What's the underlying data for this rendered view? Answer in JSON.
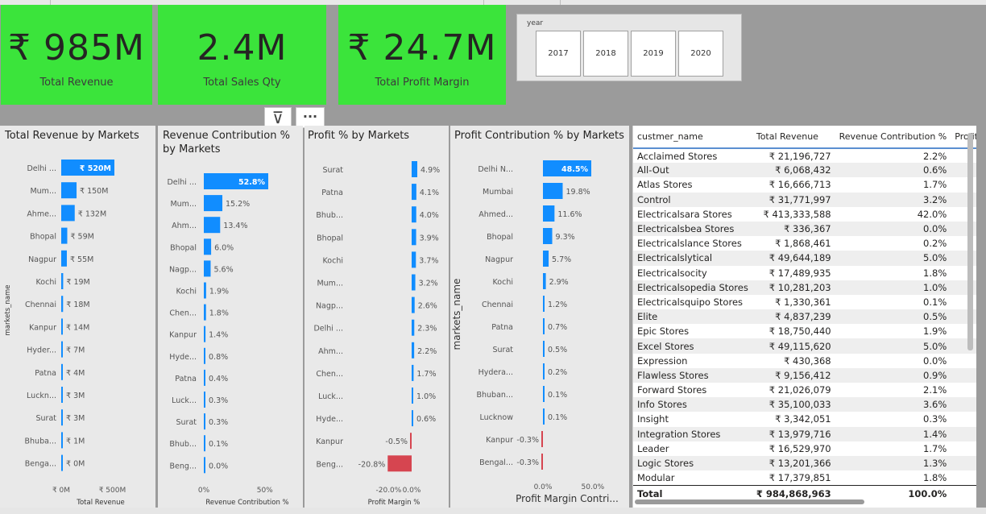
{
  "cards": [
    {
      "value": "₹ 985M",
      "label": "Total Revenue"
    },
    {
      "value": "2.4M",
      "label": "Total Sales Qty"
    },
    {
      "value": "₹ 24.7M",
      "label": "Total Profit Margin"
    }
  ],
  "slicer": {
    "title": "year",
    "options": [
      "2017",
      "2018",
      "2019",
      "2020"
    ]
  },
  "header_icons": {
    "filter": "⊽",
    "more": "···"
  },
  "colors": {
    "accent": "#118dff",
    "negative": "#d64550",
    "card_bg": "#3be43b"
  },
  "chart_data": [
    {
      "type": "bar",
      "title": "Total Revenue by Markets",
      "ylabel": "markets_name",
      "xlabel": "Total Revenue",
      "categories": [
        "Delhi ...",
        "Mum...",
        "Ahme...",
        "Bhopal",
        "Nagpur",
        "Kochi",
        "Chennai",
        "Kanpur",
        "Hyder...",
        "Patna",
        "Luckn...",
        "Surat",
        "Bhuba...",
        "Benga..."
      ],
      "values": [
        520,
        150,
        132,
        59,
        55,
        19,
        18,
        14,
        7,
        4,
        3,
        3,
        1,
        0
      ],
      "data_labels": [
        "₹ 520M",
        "₹ 150M",
        "₹ 132M",
        "₹ 59M",
        "₹ 55M",
        "₹ 19M",
        "₹ 18M",
        "₹ 14M",
        "₹ 7M",
        "₹ 4M",
        "₹ 3M",
        "₹ 3M",
        "₹ 1M",
        "₹ 0M"
      ],
      "xlim": [
        0,
        520
      ],
      "xticks": [
        "₹ 0M",
        "₹ 500M"
      ],
      "xtick_values": [
        0,
        500
      ]
    },
    {
      "type": "bar",
      "title": "Revenue Contribution % by Markets",
      "xlabel": "Revenue Contribution %",
      "categories": [
        "Delhi ...",
        "Mum...",
        "Ahm...",
        "Bhopal",
        "Nagp...",
        "Kochi",
        "Chen...",
        "Kanpur",
        "Hyde...",
        "Patna",
        "Luck...",
        "Surat",
        "Bhub...",
        "Beng..."
      ],
      "values": [
        52.8,
        15.2,
        13.4,
        6.0,
        5.6,
        1.9,
        1.8,
        1.4,
        0.8,
        0.4,
        0.3,
        0.3,
        0.1,
        0.0
      ],
      "data_labels": [
        "52.8%",
        "15.2%",
        "13.4%",
        "6.0%",
        "5.6%",
        "1.9%",
        "1.8%",
        "1.4%",
        "0.8%",
        "0.4%",
        "0.3%",
        "0.3%",
        "0.1%",
        "0.0%"
      ],
      "xlim": [
        0,
        52.8
      ],
      "xticks": [
        "0%",
        "50%"
      ],
      "xtick_values": [
        0,
        50
      ]
    },
    {
      "type": "bar",
      "title": "Profit % by Markets",
      "xlabel": "Profit Margin %",
      "categories": [
        "Surat",
        "Patna",
        "Bhub...",
        "Bhopal",
        "Kochi",
        "Mum...",
        "Nagp...",
        "Delhi ...",
        "Ahm...",
        "Chen...",
        "Luck...",
        "Hyde...",
        "Kanpur",
        "Beng..."
      ],
      "values": [
        4.9,
        4.1,
        4.0,
        3.9,
        3.7,
        3.2,
        2.6,
        2.3,
        2.2,
        1.7,
        1.0,
        0.6,
        -0.5,
        -20.8
      ],
      "data_labels": [
        "4.9%",
        "4.1%",
        "4.0%",
        "3.9%",
        "3.7%",
        "3.2%",
        "2.6%",
        "2.3%",
        "2.2%",
        "1.7%",
        "1.0%",
        "0.6%",
        "-0.5%",
        "-20.8%"
      ],
      "xlim": [
        -20.8,
        4.9
      ],
      "xticks": [
        "-20.0%",
        "0.0%"
      ],
      "xtick_values": [
        -20,
        0
      ]
    },
    {
      "type": "bar",
      "title": "Profit Contribution % by Markets",
      "ylabel": "markets_name",
      "xlabel": "Profit Margin Contri...",
      "categories": [
        "Delhi N...",
        "Mumbai",
        "Ahmed...",
        "Bhopal",
        "Nagpur",
        "Kochi",
        "Chennai",
        "Patna",
        "Surat",
        "Hydera...",
        "Bhuban...",
        "Lucknow",
        "Kanpur",
        "Bengal..."
      ],
      "values": [
        48.5,
        19.8,
        11.6,
        9.3,
        5.7,
        2.9,
        1.2,
        0.7,
        0.5,
        0.2,
        0.1,
        0.1,
        -0.3,
        -0.3
      ],
      "data_labels": [
        "48.5%",
        "19.8%",
        "11.6%",
        "9.3%",
        "5.7%",
        "2.9%",
        "1.2%",
        "0.7%",
        "0.5%",
        "0.2%",
        "0.1%",
        "0.1%",
        "-0.3%",
        "-0.3%"
      ],
      "xlim": [
        -0.3,
        48.5
      ],
      "xticks": [
        "0.0%",
        "50.0%"
      ],
      "xtick_values": [
        0,
        50
      ]
    },
    {
      "type": "table",
      "columns": [
        "custmer_name",
        "Total Revenue",
        "Revenue Contribution %",
        "Profit Margi"
      ],
      "rows": [
        [
          "Acclaimed Stores",
          "₹ 21,196,727",
          "2.2%"
        ],
        [
          "All-Out",
          "₹ 6,068,432",
          "0.6%"
        ],
        [
          "Atlas Stores",
          "₹ 16,666,713",
          "1.7%"
        ],
        [
          "Control",
          "₹ 31,771,997",
          "3.2%"
        ],
        [
          "Electricalsara Stores",
          "₹ 413,333,588",
          "42.0%"
        ],
        [
          "Electricalsbea Stores",
          "₹ 336,367",
          "0.0%"
        ],
        [
          "Electricalslance Stores",
          "₹ 1,868,461",
          "0.2%"
        ],
        [
          "Electricalslytical",
          "₹ 49,644,189",
          "5.0%"
        ],
        [
          "Electricalsocity",
          "₹ 17,489,935",
          "1.8%"
        ],
        [
          "Electricalsopedia Stores",
          "₹ 10,281,203",
          "1.0%"
        ],
        [
          "Electricalsquipo Stores",
          "₹ 1,330,361",
          "0.1%"
        ],
        [
          "Elite",
          "₹ 4,837,239",
          "0.5%"
        ],
        [
          "Epic Stores",
          "₹ 18,750,440",
          "1.9%"
        ],
        [
          "Excel Stores",
          "₹ 49,115,620",
          "5.0%"
        ],
        [
          "Expression",
          "₹ 430,368",
          "0.0%"
        ],
        [
          "Flawless Stores",
          "₹ 9,156,412",
          "0.9%"
        ],
        [
          "Forward Stores",
          "₹ 21,026,079",
          "2.1%"
        ],
        [
          "Info Stores",
          "₹ 35,100,033",
          "3.6%"
        ],
        [
          "Insight",
          "₹ 3,342,051",
          "0.3%"
        ],
        [
          "Integration Stores",
          "₹ 13,979,716",
          "1.4%"
        ],
        [
          "Leader",
          "₹ 16,529,970",
          "1.7%"
        ],
        [
          "Logic Stores",
          "₹ 13,201,366",
          "1.3%"
        ],
        [
          "Modular",
          "₹ 17,379,851",
          "1.8%"
        ]
      ],
      "total": [
        "Total",
        "₹ 984,868,963",
        "100.0%"
      ]
    }
  ]
}
